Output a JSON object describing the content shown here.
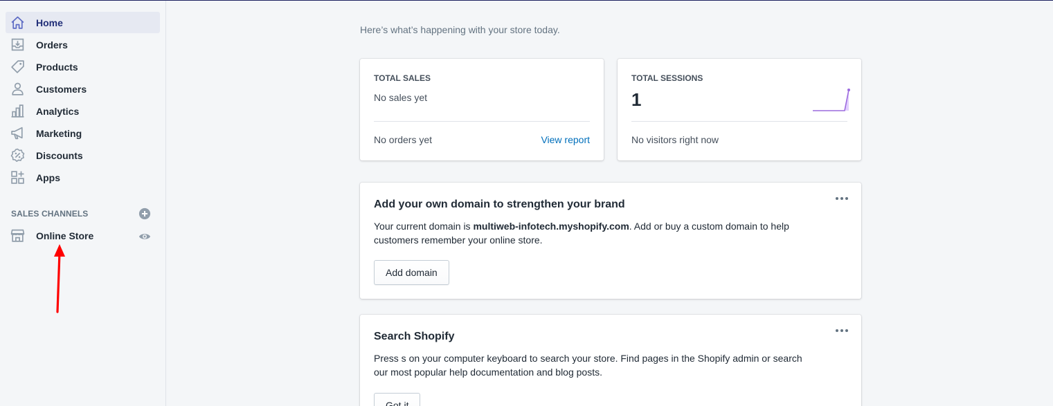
{
  "sidebar": {
    "items": [
      {
        "label": "Home",
        "icon": "home-icon",
        "active": true
      },
      {
        "label": "Orders",
        "icon": "orders-icon"
      },
      {
        "label": "Products",
        "icon": "tag-icon"
      },
      {
        "label": "Customers",
        "icon": "person-icon"
      },
      {
        "label": "Analytics",
        "icon": "bar-chart-icon"
      },
      {
        "label": "Marketing",
        "icon": "megaphone-icon"
      },
      {
        "label": "Discounts",
        "icon": "discount-icon"
      },
      {
        "label": "Apps",
        "icon": "apps-icon"
      }
    ],
    "sales_channels_heading": "SALES CHANNELS",
    "channels": [
      {
        "label": "Online Store",
        "icon": "store-icon"
      }
    ]
  },
  "main": {
    "intro": "Here’s what’s happening with your store today.",
    "total_sales": {
      "title": "TOTAL SALES",
      "subtitle": "No sales yet",
      "footer": "No orders yet",
      "link": "View report"
    },
    "total_sessions": {
      "title": "TOTAL SESSIONS",
      "value": "1",
      "footer": "No visitors right now"
    },
    "domain_card": {
      "title": "Add your own domain to strengthen your brand",
      "text_before": "Your current domain is ",
      "domain": "multiweb-infotech.myshopify.com",
      "text_after": ". Add or buy a custom domain to help customers remember your online store.",
      "button": "Add domain"
    },
    "search_card": {
      "title": "Search Shopify",
      "text": "Press s on your computer keyboard to search your store. Find pages in the Shopify admin or search our most popular help documentation and blog posts.",
      "button": "Got it"
    }
  },
  "colors": {
    "accent": "#202e78",
    "active_bg": "#e6e9f2",
    "link": "#006fbb",
    "sparkline": "#9c6ade",
    "annotation_arrow": "#ff0000"
  }
}
